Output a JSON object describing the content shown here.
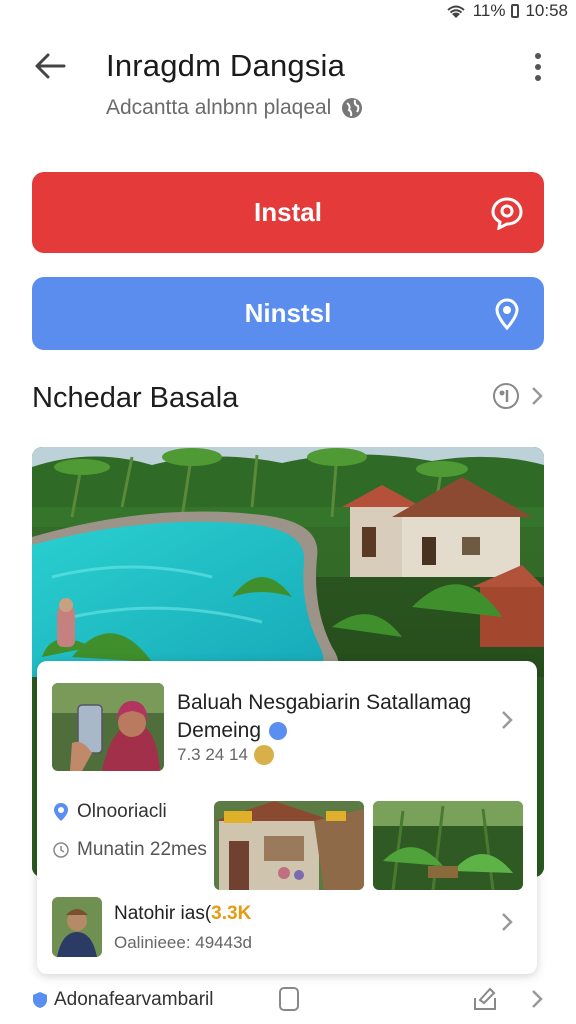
{
  "status_bar": {
    "battery": "11%",
    "time": "10:58"
  },
  "app_bar": {
    "title": "Inragdm Dangsia",
    "subtitle": "Adcantta alnbnn plaqeal"
  },
  "buttons": {
    "primary_label": "Instal",
    "secondary_label": "Ninstsl"
  },
  "section": {
    "title": "Nchedar Basala"
  },
  "post": {
    "title_line1": "Baluah Nesgabiarin Satallamag",
    "title_line2": "Demeing",
    "meta": "7.3 24 14",
    "location": "Olnooriacli",
    "time": "Munatin 22mes"
  },
  "user": {
    "name": "Natohir ias(",
    "amount": "3.3K",
    "sub": "Oalinieee: 49443d"
  },
  "bottom": {
    "label": "Adonafearvambaril"
  },
  "colors": {
    "install_red": "#e53a3a",
    "secondary_blue": "#5b8def",
    "accent_blue": "#5a8ef0"
  }
}
